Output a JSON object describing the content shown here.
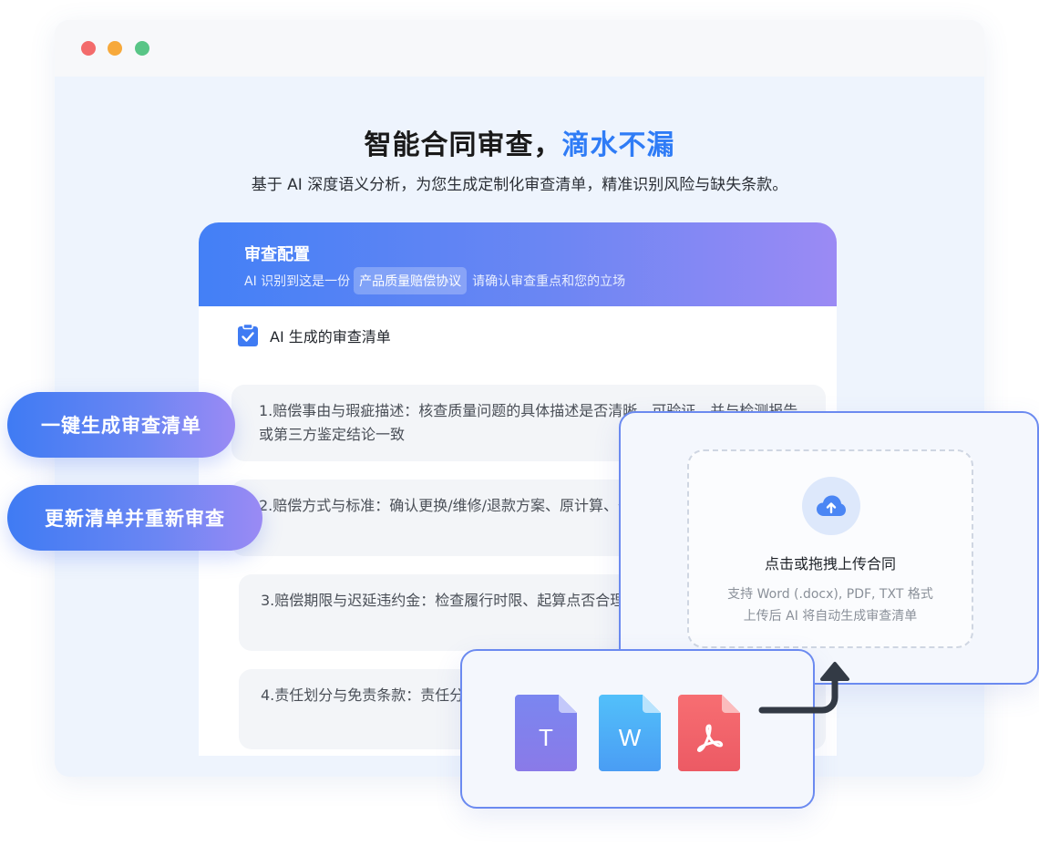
{
  "window": {
    "dots": [
      "close",
      "minimize",
      "maximize"
    ]
  },
  "hero": {
    "title_main": "智能合同审查，",
    "title_accent": "滴水不漏",
    "subtitle": "基于 AI 深度语义分析，为您生成定制化审查清单，精准识别风险与缺失条款。"
  },
  "panel": {
    "title": "审查配置",
    "line_prefix": "AI 识别到这是一份",
    "contract_type": "产品质量赔偿协议",
    "line_suffix": "请确认审查重点和您的立场",
    "checklist_title": "AI 生成的审查清单",
    "items": [
      {
        "text": "1.赔偿事由与瑕疵描述：核查质量问题的具体描述是否清晰、可验证，并与检测报告或第三方鉴定结论一致"
      },
      {
        "text": "2.赔偿方式与标准：确认更换/维修/退款方案、原计算、备用机提供等细节是否明确"
      },
      {
        "text": "3.赔偿期限与迟延违约金：检查履行时限、起算点否合理且可执行"
      },
      {
        "text": "4.责任划分与免责条款：责任分担作出公平约定，"
      }
    ]
  },
  "actions": {
    "generate_label": "一键生成审查清单",
    "update_label": "更新清单并重新审查"
  },
  "upload": {
    "title": "点击或拖拽上传合同",
    "formats": "支持 Word (.docx), PDF, TXT 格式",
    "hint": "上传后 AI 将自动生成审查清单"
  },
  "files": [
    {
      "icon": "txt-file-icon",
      "letter": "T",
      "color": "#7b80ee"
    },
    {
      "icon": "word-file-icon",
      "letter": "W",
      "color": "#4ab3f7"
    },
    {
      "icon": "pdf-file-icon",
      "letter": "",
      "color": "#f0656a"
    }
  ],
  "colors": {
    "accent": "#2f7cf6",
    "gradient_start": "#4380f6",
    "gradient_end": "#9b8af4",
    "card_border": "#6b8af0"
  }
}
